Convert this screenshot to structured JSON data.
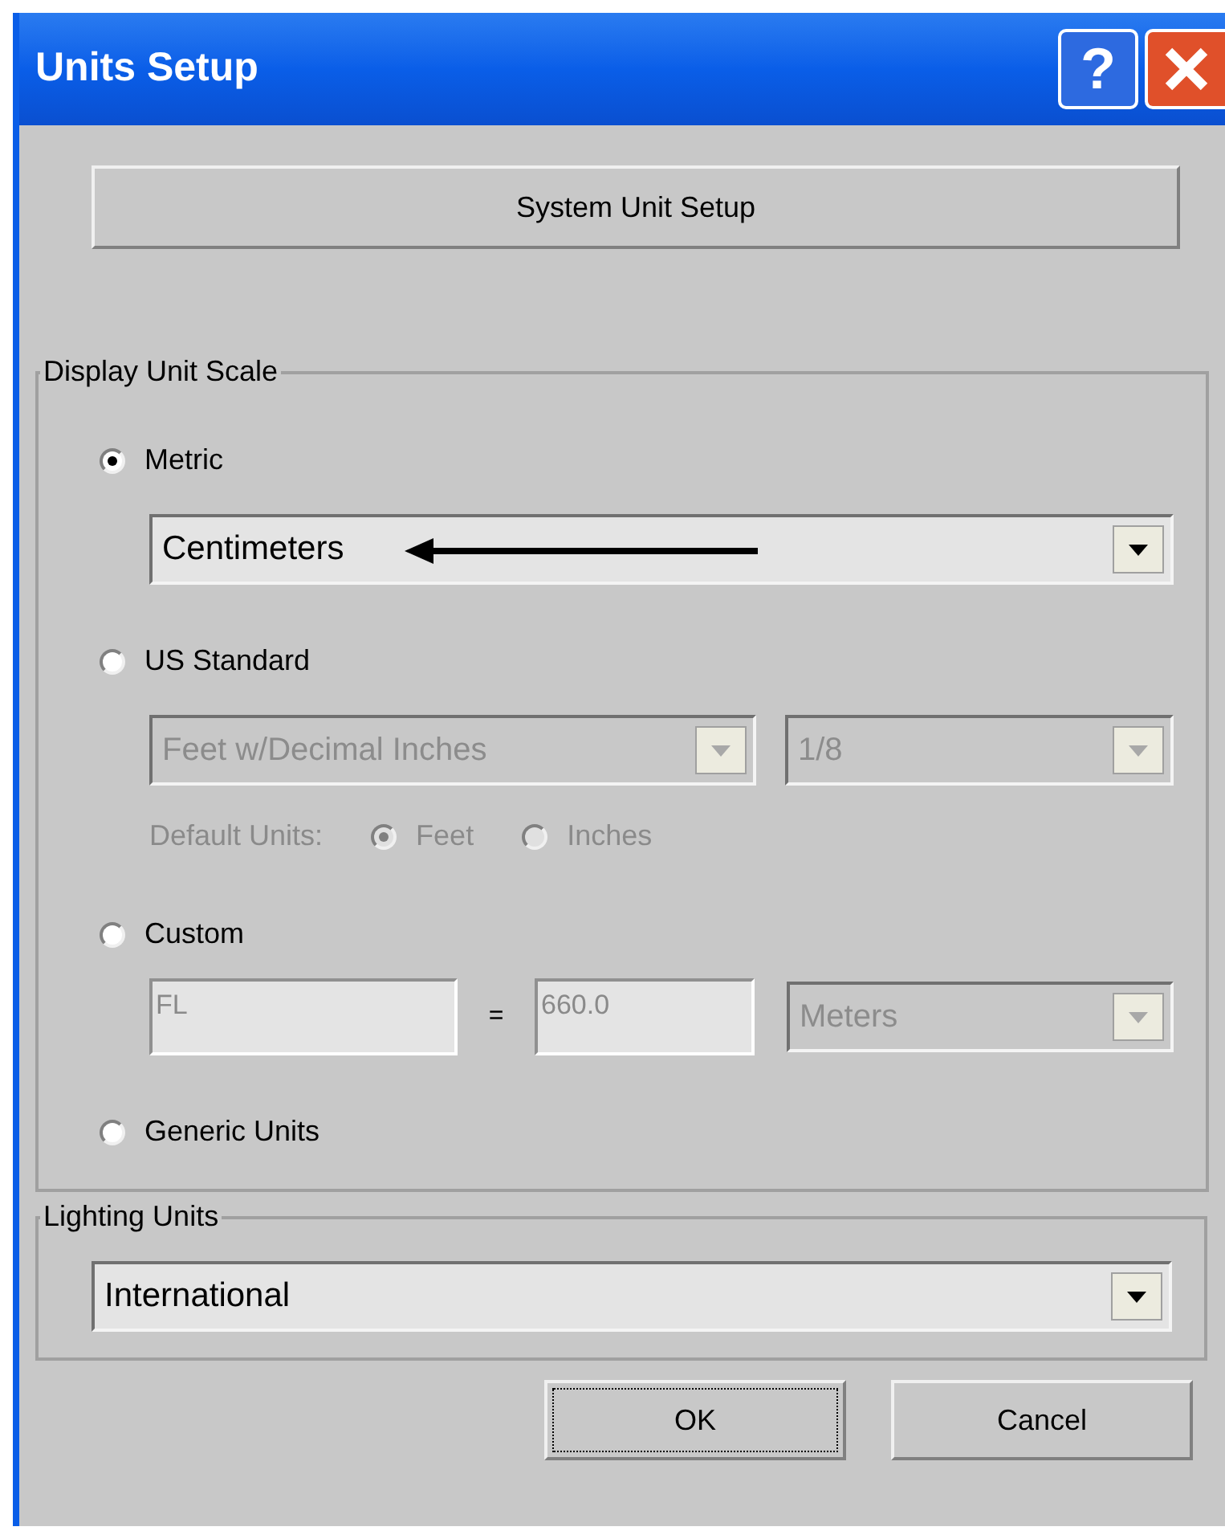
{
  "window": {
    "title": "Units Setup",
    "help_button": "?"
  },
  "system_button": "System Unit Setup",
  "display_unit_scale": {
    "label": "Display Unit Scale",
    "options": [
      {
        "label": "Metric",
        "selected": true,
        "dropdowns": [
          {
            "value": "Centimeters",
            "disabled": false
          }
        ]
      },
      {
        "label": "US Standard",
        "selected": false,
        "dropdowns": [
          {
            "value": "Feet w/Decimal Inches",
            "disabled": true
          },
          {
            "value": "1/8",
            "disabled": true
          }
        ],
        "default_units": {
          "label": "Default Units:",
          "disabled": true,
          "options": [
            {
              "label": "Feet",
              "selected": true
            },
            {
              "label": "Inches",
              "selected": false
            }
          ]
        }
      },
      {
        "label": "Custom",
        "selected": false,
        "custom": {
          "name": "FL",
          "equals": "=",
          "value": "660.0",
          "unit": "Meters",
          "disabled": true
        }
      },
      {
        "label": "Generic Units",
        "selected": false
      }
    ]
  },
  "lighting_units": {
    "label": "Lighting Units",
    "dropdown": {
      "value": "International",
      "disabled": false
    }
  },
  "buttons": [
    {
      "label": "OK",
      "focused": true
    },
    {
      "label": "Cancel",
      "focused": false
    }
  ]
}
